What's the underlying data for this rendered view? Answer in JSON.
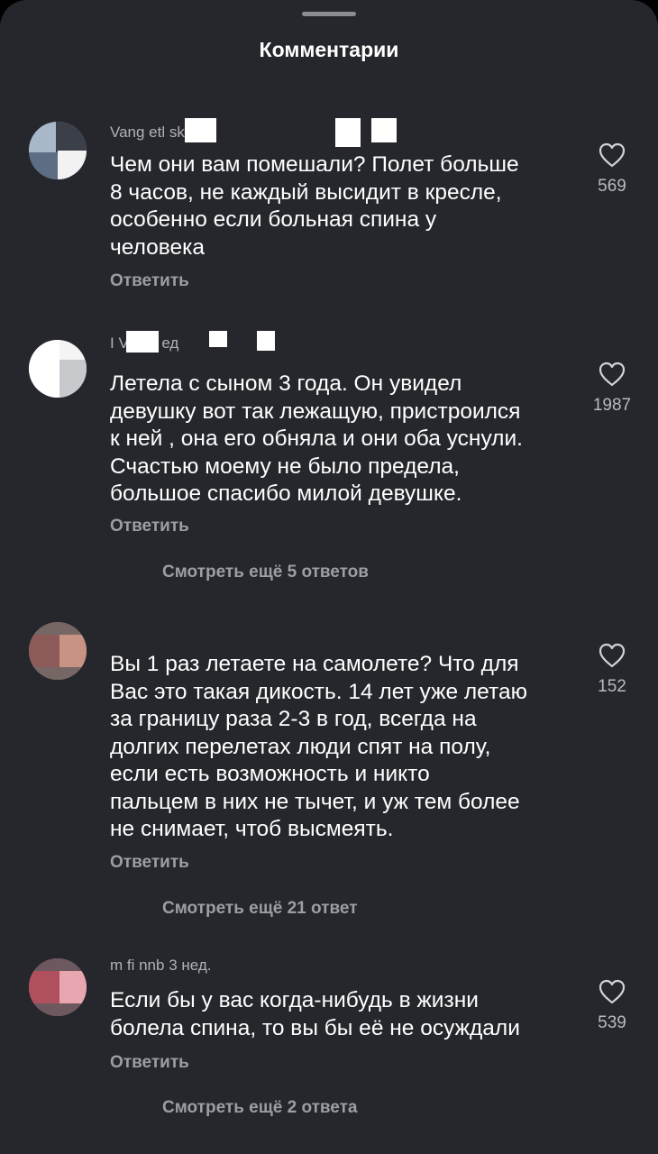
{
  "header": {
    "title": "Комментарии"
  },
  "comments": [
    {
      "username": "Vang    etl    sk",
      "lines": [
        "Чем они вам помешали? Полет больше",
        "8 часов, не каждый высидит в кресле,",
        "особенно если больная спина у",
        "человека"
      ],
      "likes": "569",
      "reply": "Ответить"
    },
    {
      "username": "I   Vi   o   2   ед",
      "lines": [
        "Летела с сыном 3 года. Он увидел",
        "девушку вот так лежащую, пристроился",
        "к ней , она его обняла и они оба уснули.",
        "Счастью моему не было предела,",
        "большое спасибо милой девушке."
      ],
      "likes": "1987",
      "reply": "Ответить",
      "more": "Смотреть ещё 5 ответов"
    },
    {
      "username": "",
      "lines": [
        "Вы 1 раз летаете на самолете? Что для",
        "Вас это такая дикость. 14 лет уже летаю",
        "за границу раза 2-3 в год, всегда на",
        "долгих перелетах люди спят на полу,",
        "если есть возможность и никто",
        "пальцем в них не тычет, и уж тем более",
        "не снимает, чтоб высмеять."
      ],
      "likes": "152",
      "reply": "Ответить",
      "more": "Смотреть ещё 21 ответ"
    },
    {
      "username": "m   fi   nnb   3 нед.",
      "lines": [
        "Если бы у вас когда-нибудь в жизни",
        "болела спина, то вы бы её не осуждали"
      ],
      "likes": "539",
      "reply": "Ответить",
      "more": "Смотреть ещё 2 ответа"
    }
  ],
  "colors": {
    "background": "#25272c",
    "text": "#ffffff",
    "muted": "#9c9ea3"
  }
}
